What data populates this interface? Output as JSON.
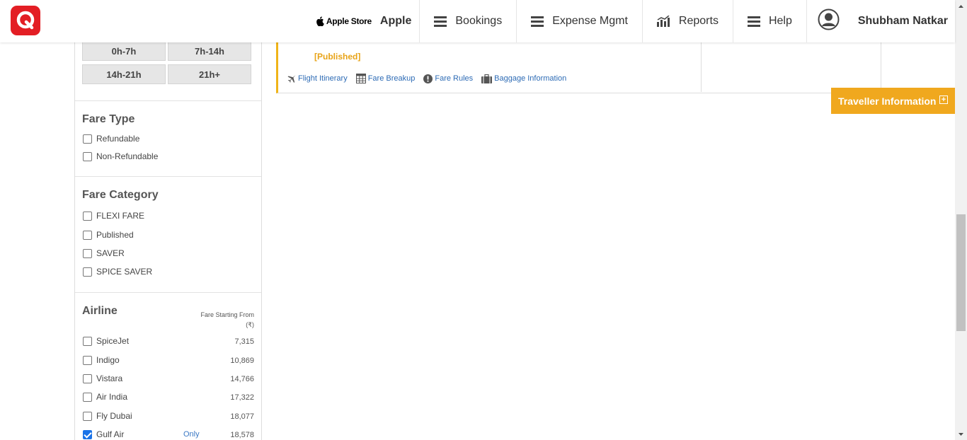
{
  "header": {
    "logo_letter": "Q",
    "apple_store_label": "Apple Store",
    "apple_label": "Apple",
    "nav": [
      {
        "label": "Bookings",
        "icon": "menu-icon"
      },
      {
        "label": "Expense Mgmt",
        "icon": "menu-icon"
      },
      {
        "label": "Reports",
        "icon": "bar-chart-icon"
      },
      {
        "label": "Help",
        "icon": "menu-icon"
      }
    ],
    "user_name": "Shubham Natkar"
  },
  "sidebar": {
    "duration_buttons": [
      "0h-7h",
      "7h-14h",
      "14h-21h",
      "21h+"
    ],
    "fare_type": {
      "title": "Fare Type",
      "options": [
        "Refundable",
        "Non-Refundable"
      ]
    },
    "fare_category": {
      "title": "Fare Category",
      "options": [
        "FLEXI FARE",
        "Published",
        "SAVER",
        "SPICE SAVER"
      ]
    },
    "airline": {
      "title": "Airline",
      "fare_heading": "Fare Starting From",
      "currency": "(₹)",
      "only_label": "Only",
      "items": [
        {
          "name": "SpiceJet",
          "fare": "7,315",
          "checked": false
        },
        {
          "name": "Indigo",
          "fare": "10,869",
          "checked": false
        },
        {
          "name": "Vistara",
          "fare": "14,766",
          "checked": false
        },
        {
          "name": "Air India",
          "fare": "17,322",
          "checked": false
        },
        {
          "name": "Fly Dubai",
          "fare": "18,077",
          "checked": false
        },
        {
          "name": "Gulf Air",
          "fare": "18,578",
          "checked": true
        }
      ]
    }
  },
  "result": {
    "fare_tag": "[Published]",
    "links": [
      "Flight Itinerary",
      "Fare Breakup",
      "Fare Rules",
      "Baggage Information"
    ]
  },
  "traveller_button": {
    "label": "Traveller Information",
    "expand_symbol": "+"
  },
  "colors": {
    "brand_red": "#e31e24",
    "accent_orange": "#f0a81e",
    "link_blue": "#2d6bb5"
  }
}
